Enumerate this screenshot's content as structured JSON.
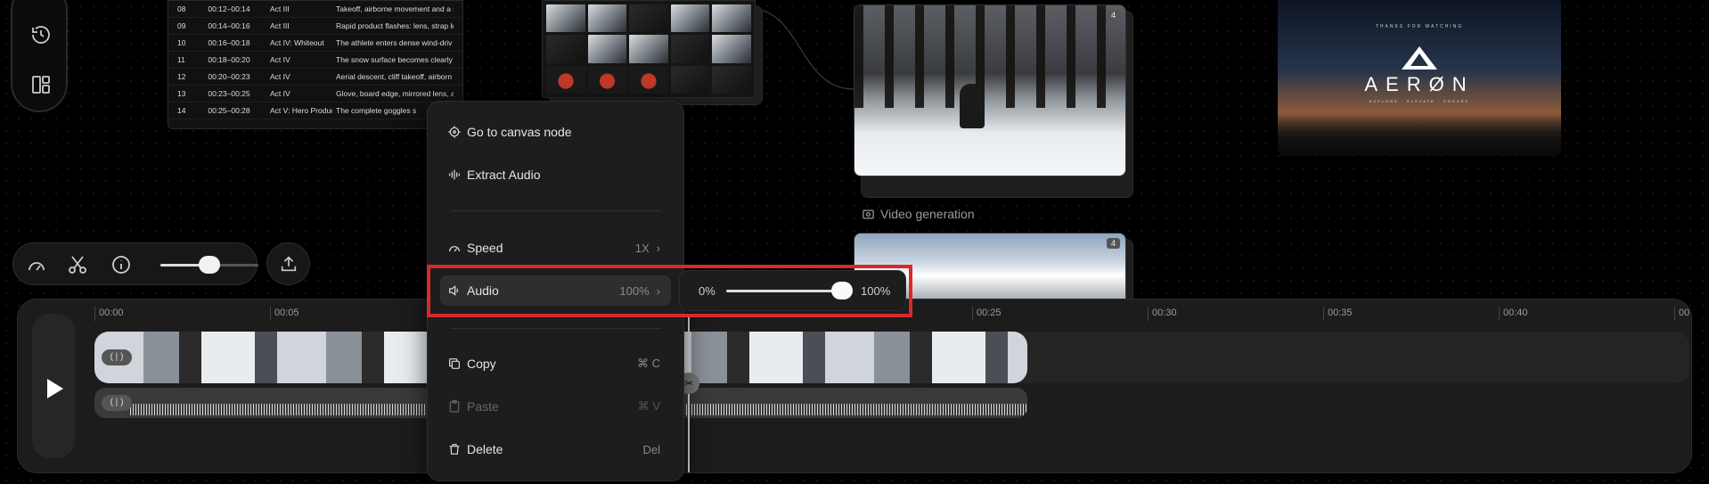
{
  "table_rows": [
    {
      "num": "08",
      "time": "00:12–00:14",
      "act": "Act III",
      "desc": "Takeoff, airborne movement and a s"
    },
    {
      "num": "09",
      "time": "00:14–00:16",
      "act": "Act III",
      "desc": "Rapid product flashes: lens, strap lo"
    },
    {
      "num": "10",
      "time": "00:16–00:18",
      "act": "Act IV: Whiteout",
      "desc": "The athlete enters dense wind-driv"
    },
    {
      "num": "11",
      "time": "00:18–00:20",
      "act": "Act IV",
      "desc": "The snow surface becomes clearly"
    },
    {
      "num": "12",
      "time": "00:20–00:23",
      "act": "Act IV",
      "desc": "Aerial descent, cliff takeoff, airborn"
    },
    {
      "num": "13",
      "time": "00:23–00:25",
      "act": "Act IV",
      "desc": "Glove, board edge, mirrored lens, a"
    },
    {
      "num": "14",
      "time": "00:25–00:28",
      "act": "Act V: Hero Product",
      "desc": "The complete goggles s"
    }
  ],
  "video_node_top": {
    "badge": "4"
  },
  "video_generation_label": "Video generation",
  "video_node_bottom": {
    "badge": "4"
  },
  "end_card": {
    "thanks": "THANKS FOR WATCHING",
    "brand": "AERØN",
    "tagline": "EXPLORE · ELEVATE · ENDURE"
  },
  "timeline": {
    "ticks": [
      "00:00",
      "00:05",
      "00:25",
      "00:30",
      "00:35",
      "00:40",
      "00"
    ],
    "clip_handle": "( | )"
  },
  "context_menu": {
    "go_to_node": "Go to canvas node",
    "extract_audio": "Extract Audio",
    "speed": {
      "label": "Speed",
      "value": "1X"
    },
    "audio": {
      "label": "Audio",
      "value": "100%"
    },
    "copy": {
      "label": "Copy",
      "shortcut": "⌘  C"
    },
    "paste": {
      "label": "Paste",
      "shortcut": "⌘  V"
    },
    "delete": {
      "label": "Delete",
      "shortcut": "Del"
    }
  },
  "audio_submenu": {
    "min_label": "0%",
    "max_label": "100%",
    "volume_percent": 100
  },
  "mini_toolbar": {
    "zoom_fraction": 0.5
  },
  "colors": {
    "highlight": "#d62a2a",
    "background": "#000000"
  }
}
